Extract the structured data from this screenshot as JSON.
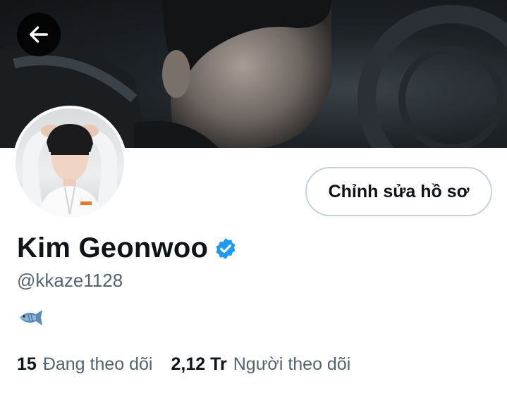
{
  "profile": {
    "display_name": "Kim Geonwoo",
    "handle": "@kkaze1128",
    "verified": true,
    "bio_emoji": "fish-icon"
  },
  "actions": {
    "edit_profile_label": "Chỉnh sửa hồ sơ",
    "back": "arrow-left-icon"
  },
  "stats": {
    "following_count": "15",
    "following_label": "Đang theo dõi",
    "followers_count": "2,12 Tr",
    "followers_label": "Người theo dõi"
  },
  "colors": {
    "verified_blue": "#1d9bf0",
    "text_primary": "#0f1419",
    "text_secondary": "#536471",
    "button_border": "#c9d1d8"
  }
}
